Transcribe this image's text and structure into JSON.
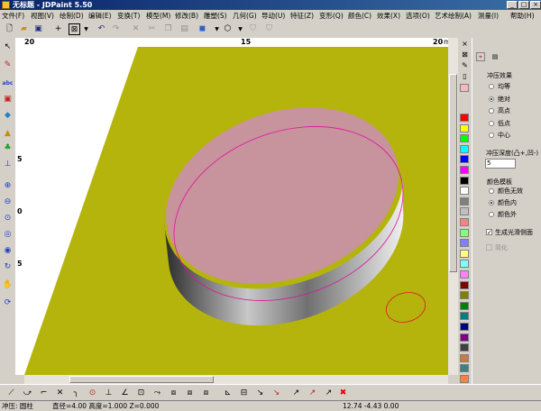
{
  "window": {
    "title": "无标题 - JDPaint 5.50"
  },
  "menu": [
    "文件(F)",
    "视图(V)",
    "绘制(D)",
    "编辑(E)",
    "变换(T)",
    "模型(M)",
    "修改(B)",
    "雕塑(S)",
    "几何(G)",
    "导动(U)",
    "特征(Z)",
    "变形(Q)",
    "颜色(C)",
    "效果(X)",
    "选项(O)",
    "艺术绘制(A)",
    "测量(I)",
    "帮助(H)"
  ],
  "ruler": {
    "h_left": "20",
    "h_mid": "15",
    "h_right": "20",
    "h_unit": "mm",
    "v_5_top": "5",
    "v_0": "0",
    "v_5_bottom": "5"
  },
  "panel": {
    "group1_title": "冲压效果",
    "group1_options": [
      "均等",
      "绝对",
      "高点",
      "低点",
      "中心"
    ],
    "group1_selected": 1,
    "depth_label": "冲压深度(凸+,凹-)",
    "depth_value": "5",
    "group2_title": "颜色模板",
    "group2_options": [
      "颜色无效",
      "颜色内",
      "颜色外"
    ],
    "group2_selected": 1,
    "smooth_label": "生成光滑侧面",
    "smooth_checked": true,
    "simplify_label": "简化",
    "simplify_checked": false
  },
  "palette_colors": [
    "#ff0000",
    "#ffff00",
    "#00ff00",
    "#00ffff",
    "#0000ff",
    "#ff00ff",
    "#000000",
    "#ffffff",
    "#808080",
    "#c0c0c0",
    "#ff8080",
    "#80ff80",
    "#8080ff",
    "#ffff80",
    "#80ffff",
    "#ff80ff",
    "#800000",
    "#808000",
    "#008000",
    "#008080",
    "#000080",
    "#800080",
    "#404040",
    "#c08040",
    "#408080",
    "#ff8040",
    "#4080ff",
    "#c0c0ff"
  ],
  "status": {
    "mode": "冲压: 圆柱",
    "params": "直径=4.00  高度=1.000  Z=0.000",
    "coords": "12.74  -4.43  0.00"
  },
  "colors": {
    "plate": "#b5b40c",
    "disk_top": "#c7939d",
    "outline": "#e0109a"
  }
}
